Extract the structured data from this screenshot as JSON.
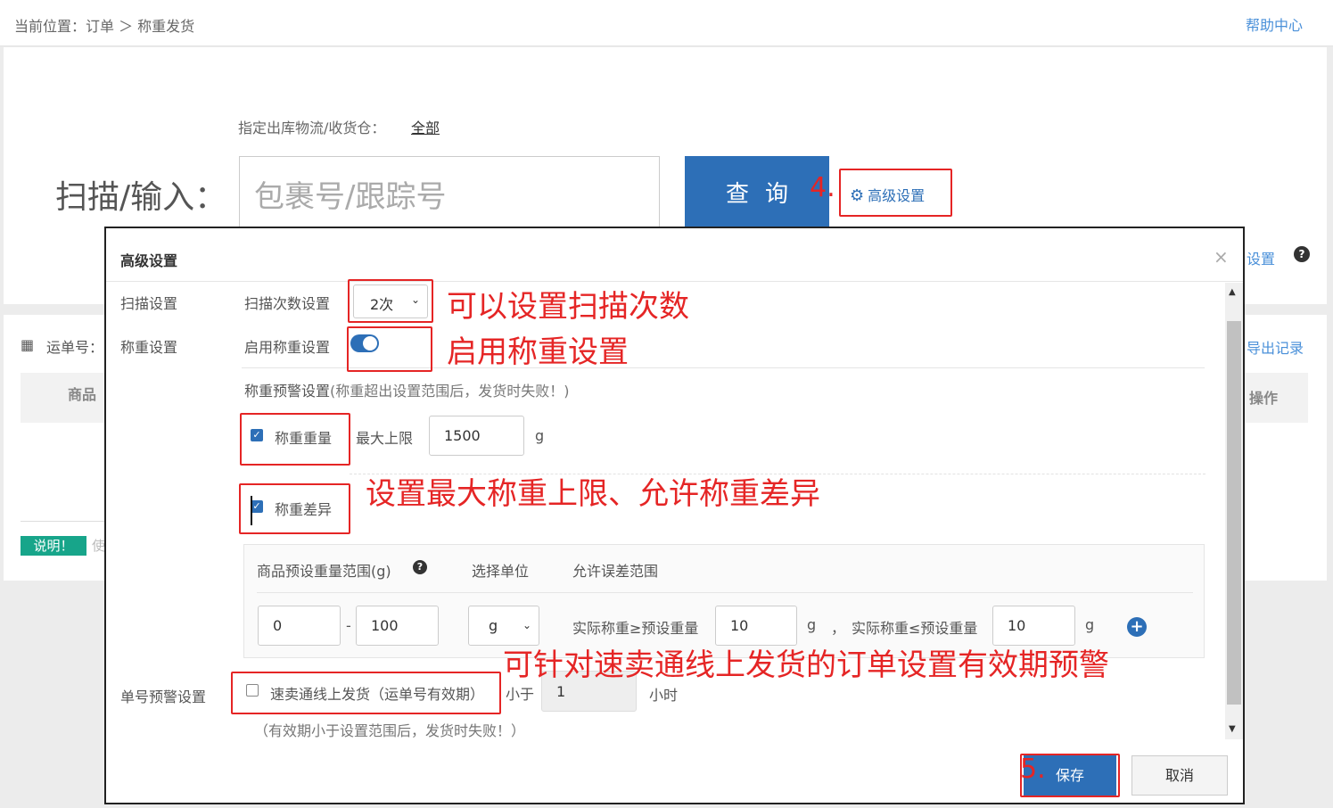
{
  "header": {
    "breadcrumb": "当前位置：订单 ＞ 称重发货",
    "help_link": "帮助中心"
  },
  "scan_panel": {
    "warehouse_label": "指定出库物流/收货仓：",
    "warehouse_value": "全部",
    "scan_label": "扫描/输入：",
    "scan_placeholder": "包裹号/跟踪号",
    "query_button": "查询",
    "advanced_button": "高级设置",
    "step_marker": "4.",
    "right_link": "设置"
  },
  "list_panel": {
    "waybill_label": "运单号：",
    "export_link": "导出记录",
    "col_goods": "商品",
    "col_operation": "操作",
    "note_badge": "说明！",
    "note_text": "使"
  },
  "modal": {
    "title": "高级设置",
    "close": "×",
    "scan_section": {
      "label": "扫描设置",
      "field_label": "扫描次数设置",
      "selected": "2次"
    },
    "weigh_section": {
      "label": "称重设置",
      "enable_label": "启用称重设置",
      "enabled": true,
      "warning_title": "称重预警设置",
      "warning_note": "(称重超出设置范围后，发货时失败！)",
      "weight_check_label": "称重重量",
      "weight_checked": true,
      "max_label": "最大上限",
      "max_value": "1500",
      "unit": "g",
      "diff_check_label": "称重差异",
      "diff_checked": true,
      "table": {
        "col_preset": "商品预设重量范围(g)",
        "col_unit": "选择单位",
        "col_tolerance": "允许误差范围",
        "min": "0",
        "range_dash": "-",
        "max": "100",
        "unit_selected": "g",
        "ge_label": "实际称重≥预设重量",
        "ge_value": "10",
        "ge_unit": "g",
        "comma": "，",
        "le_label": "实际称重≤预设重量",
        "le_value": "10",
        "le_unit": "g",
        "add": "+"
      }
    },
    "order_section": {
      "label": "单号预警设置",
      "express_label": "速卖通线上发货（运单号有效期）",
      "express_checked": false,
      "less_than": "小于",
      "hours_value": "1",
      "hours_unit": "小时",
      "note": "（有效期小于设置范围后，发货时失败！）"
    },
    "save_button": "保存",
    "cancel_button": "取消",
    "step_marker": "5."
  },
  "annotations": {
    "scan_count": "可以设置扫描次数",
    "enable_weigh": "启用称重设置",
    "weight_limits": "设置最大称重上限、允许称重差异",
    "express_warning": "可针对速卖通线上发货的订单设置有效期预警"
  },
  "colors": {
    "primary": "#2d6fb7",
    "annotation": "#e52525",
    "badge": "#17a58a"
  }
}
